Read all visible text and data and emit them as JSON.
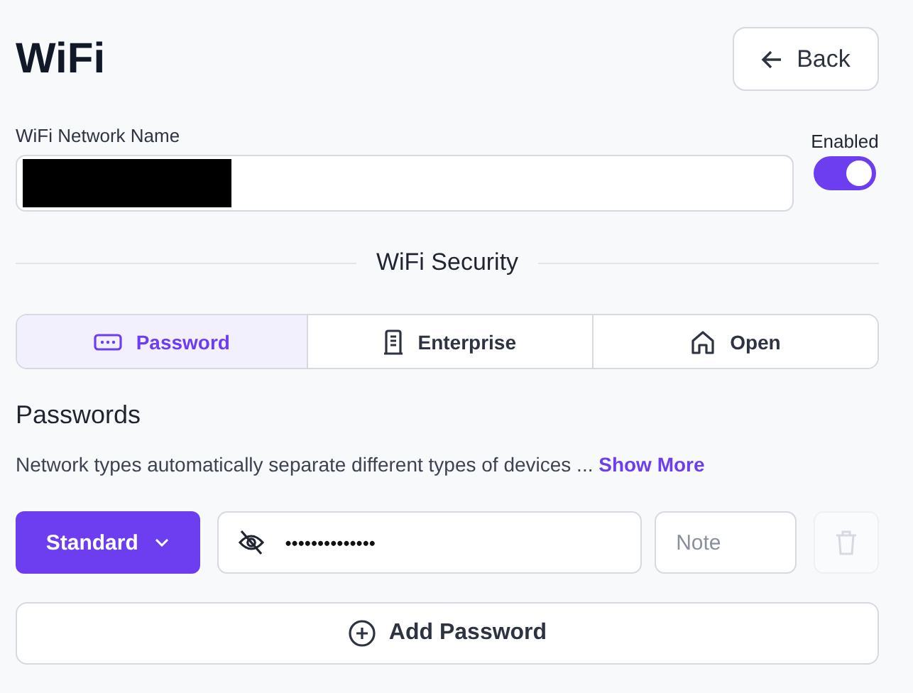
{
  "header": {
    "title": "WiFi",
    "back_button": "Back"
  },
  "network_name": {
    "label": "WiFi Network Name",
    "redacted": true
  },
  "enabled_toggle": {
    "label": "Enabled",
    "on": true
  },
  "security": {
    "heading": "WiFi Security",
    "tabs": [
      {
        "label": "Password",
        "kind": "password",
        "selected": true
      },
      {
        "label": "Enterprise",
        "kind": "enterprise",
        "selected": false
      },
      {
        "label": "Open",
        "kind": "open",
        "selected": false
      }
    ]
  },
  "passwords": {
    "heading": "Passwords",
    "description": "Network types automatically separate different types of devices ...",
    "show_more": "Show More",
    "rows": [
      {
        "type": "Standard",
        "value": "••••••••••••••",
        "note_placeholder": "Note",
        "delete_disabled": true
      }
    ],
    "add_button": "Add Password"
  }
}
